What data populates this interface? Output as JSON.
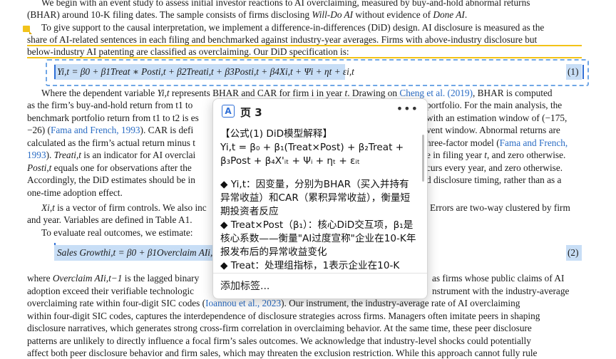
{
  "doc": {
    "l1": "We begin with an event study to assess initial investor reactions to AI overclaiming, measured by buy-and-hold abnormal returns",
    "l2a": "(BHAR) around 10-K filing dates. The sample consists of firms disclosing ",
    "l2b": "Will-Do AI",
    "l2c": " without evidence of ",
    "l2d": "Done AI",
    "l2e": ".",
    "l3": "To give support to the causal interpretation, we implement a difference-in-differences (DiD) design. AI disclosure is measured as the",
    "l4": "share of AI-related sentences in each filing and benchmarked against industry-year averages. Firms with above-industry disclosure but",
    "l5": "below-industry AI patenting are classified as overclaiming. Our DiD specification is:",
    "eq1": "Yi,t = β0 + β1Treat ∗ Posti,t + β2Treati,t + β3Posti,t + β4Xi,t + Ψi + ηt + εi,t",
    "eq1_num": "(1)",
    "l7a": "Where the dependent variable ",
    "l7b": "Yi,t",
    "l7c": " represents BHAR and CAR for firm i in year ",
    "l7d": "t",
    "l7e": ". Drawing on ",
    "l7f": "Cheng et al. (2019)",
    "l7g": ", BHAR is computed",
    "l8a": "as the firm’s buy-and-hold return from t1 to",
    "l8b": "portfolio. For the main analysis, the",
    "l9a": "benchmark portfolio return from t1 to t2 is es",
    "l9b": "with an estimation window of (−175,",
    "l10a": "−26) (",
    "l10b": "Fama and French, 1993",
    "l10c": "). CAR is defi",
    "l10d": "vent window. Abnormal returns are",
    "l11a": "calculated as the firm’s actual return minus t",
    "l11b": "hree-factor model (",
    "l11c": "Fama and French,",
    "l12a": "1993",
    "l12b": "). ",
    "l12c": "Treati,t",
    "l12d": " is an indicator for AI overclai",
    "l12e": "e in filing year ",
    "l12f": "t",
    "l12g": ", and zero otherwise.",
    "l13a": "Posti,t",
    "l13b": " equals one for observations after the",
    "l13c": "curs every year, and zero otherwise.",
    "l14a": "Accordingly, the DiD estimates should be in",
    "l14b": "d disclosure timing, rather than as a",
    "l15": "one-time adoption effect.",
    "l16a": "Xi,t",
    "l16b": " is a vector of firm controls. We also inc",
    "l16c": "Errors are two-way clustered by firm",
    "l17": "and year. Variables are defined in Table A1.",
    "l18": "To evaluate real outcomes, we estimate:",
    "eq2": "Sales Growthi,t = β0 + β1Overclaim AIi,",
    "eq2_num": "(2)",
    "l20a": "where ",
    "l20b": "Overclaim AIi,t−1",
    "l20c": " is the lagged binary",
    "l20d": "as firms whose public claims of AI",
    "l21a": "adoption exceed their verifiable technologic",
    "l21b": "nstrument with the industry-average",
    "l22a": "overclaiming rate within four-digit SIC codes (",
    "l22b": "Ioannou et al., 2023",
    "l22c": "). Our instrument, the industry-average rate of AI overclaiming",
    "l23": "within four-digit SIC codes, captures the interdependence of disclosure strategies across firms. Managers often imitate peers in shaping",
    "l24": "disclosure narratives, which generates strong cross-firm correlation in overclaiming behavior. At the same time, these peer disclosure",
    "l25": "patterns are unlikely to directly influence a focal firm’s sales outcomes. We acknowledge that industry-level shocks could potentially",
    "l26": "affect both peer disclosure behavior and firm sales, which may threaten the exclusion restriction. While this approach cannot fully rule"
  },
  "popup": {
    "icon": "A",
    "icon_name": "page-annotation-icon",
    "title": "页 3",
    "more": "•••",
    "heading": "【公式(1) DiD模型解释】",
    "formula": "Yi,t = β₀ + β₁(Treat×Post) + β₂Treat + β₃Post + β₄X'ᵢₜ + Ψᵢ + ηₜ + εᵢₜ",
    "b1": "◆ Yi,t：因变量，分别为BHAR（买入并持有异常收益）和CAR（累积异常收益），衡量短期投资者反应",
    "b2": "◆ Treat×Post（β₁）：核心DiD交互项，β₁是核心系数——衡量\"AI过度宣称\"企业在10-K年报发布后的异常收益变化",
    "b3": "◆ Treat：处理组指标，1表示企业在10-K",
    "footer": "添加标签..."
  }
}
